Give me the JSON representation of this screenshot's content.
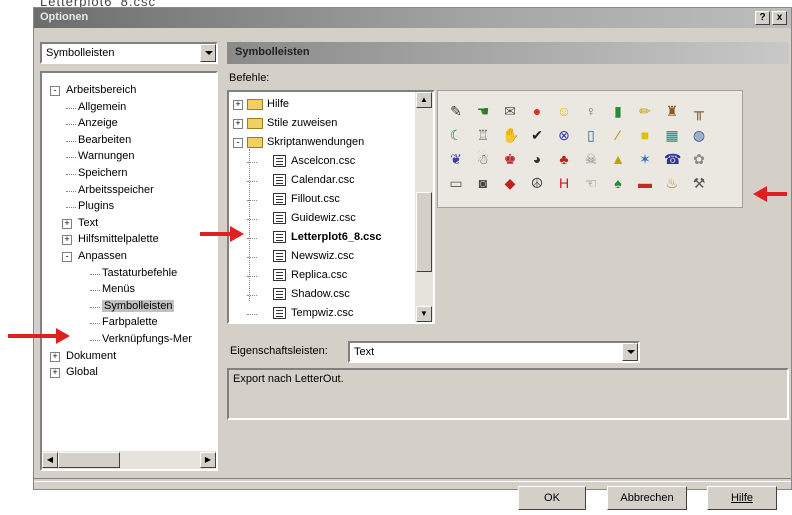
{
  "top_text": "Letterplot6_8.csc",
  "window": {
    "title": "Optionen",
    "help_btn": "?",
    "close_btn": "x"
  },
  "category_combo": {
    "value": "Symbolleisten"
  },
  "left_tree": [
    {
      "label": "Arbeitsbereich",
      "level": 0,
      "expander": "-"
    },
    {
      "label": "Allgemein",
      "level": 1
    },
    {
      "label": "Anzeige",
      "level": 1
    },
    {
      "label": "Bearbeiten",
      "level": 1
    },
    {
      "label": "Warnungen",
      "level": 1
    },
    {
      "label": "Speichern",
      "level": 1
    },
    {
      "label": "Arbeitsspeicher",
      "level": 1
    },
    {
      "label": "Plugins",
      "level": 1
    },
    {
      "label": "Text",
      "level": 1,
      "expander": "+"
    },
    {
      "label": "Hilfsmittelpalette",
      "level": 1,
      "expander": "+"
    },
    {
      "label": "Anpassen",
      "level": 1,
      "expander": "-"
    },
    {
      "label": "Tastaturbefehle",
      "level": 2
    },
    {
      "label": "Menüs",
      "level": 2
    },
    {
      "label": "Symbolleisten",
      "level": 2,
      "selected": true
    },
    {
      "label": "Farbpalette",
      "level": 2
    },
    {
      "label": "Verknüpfungs-Mer",
      "level": 2
    },
    {
      "label": "Dokument",
      "level": 0,
      "expander": "+"
    },
    {
      "label": "Global",
      "level": 0,
      "expander": "+"
    }
  ],
  "section_header": "Symbolleisten",
  "commands_label": "Befehle:",
  "commands_tree": [
    {
      "label": "Hilfe",
      "type": "folder",
      "expander": "+"
    },
    {
      "label": "Stile zuweisen",
      "type": "folder",
      "expander": "+"
    },
    {
      "label": "Skriptanwendungen",
      "type": "folder",
      "expander": "-"
    },
    {
      "label": "Ascelcon.csc",
      "type": "file"
    },
    {
      "label": "Calendar.csc",
      "type": "file"
    },
    {
      "label": "Fillout.csc",
      "type": "file"
    },
    {
      "label": "Guidewiz.csc",
      "type": "file"
    },
    {
      "label": "Letterplot6_8.csc",
      "type": "file",
      "highlight": true
    },
    {
      "label": "Newswiz.csc",
      "type": "file"
    },
    {
      "label": "Replica.csc",
      "type": "file"
    },
    {
      "label": "Shadow.csc",
      "type": "file"
    },
    {
      "label": "Tempwiz.csc",
      "type": "file"
    }
  ],
  "icon_grid": [
    [
      "pen-icon",
      "hand-icon",
      "mail-icon",
      "stop-icon",
      "smiley-icon",
      "bulb-icon",
      "book-icon",
      "pencil-icon",
      "chair-icon",
      "table-icon"
    ],
    [
      "moon-icon",
      "bottle-icon",
      "glove-icon",
      "check-icon",
      "no-icon",
      "page-icon",
      "wand-icon",
      "cube-icon",
      "grid-icon",
      "globe-icon"
    ],
    [
      "butterfly-icon",
      "figure-icon",
      "person-icon",
      "camera-icon",
      "car-icon",
      "skull-icon",
      "bell-icon",
      "star-icon",
      "phone-icon",
      "flower-icon"
    ],
    [
      "card-icon",
      "chip-icon",
      "lips-icon",
      "peace-icon",
      "h-icon",
      "hand-point-icon",
      "tree-icon",
      "sofa-icon",
      "pumpkin-icon",
      "tools-icon"
    ]
  ],
  "icon_glyphs": {
    "pen-icon": "✎",
    "hand-icon": "☚",
    "mail-icon": "✉",
    "stop-icon": "●",
    "smiley-icon": "☺",
    "bulb-icon": "♀",
    "book-icon": "▮",
    "pencil-icon": "✏",
    "chair-icon": "♜",
    "table-icon": "╥",
    "moon-icon": "☾",
    "bottle-icon": "♖",
    "glove-icon": "✋",
    "check-icon": "✔",
    "no-icon": "⊗",
    "page-icon": "▯",
    "wand-icon": "⁄",
    "cube-icon": "■",
    "grid-icon": "▦",
    "globe-icon": "◍",
    "butterfly-icon": "❦",
    "figure-icon": "☃",
    "person-icon": "♚",
    "camera-icon": "◕",
    "car-icon": "♣",
    "skull-icon": "☠",
    "bell-icon": "▲",
    "star-icon": "✶",
    "phone-icon": "☎",
    "flower-icon": "✿",
    "card-icon": "▭",
    "chip-icon": "◙",
    "lips-icon": "◆",
    "peace-icon": "☮",
    "h-icon": "H",
    "hand-point-icon": "☜",
    "tree-icon": "♠",
    "sofa-icon": "▬",
    "pumpkin-icon": "♨",
    "tools-icon": "⚒"
  },
  "icon_colors": [
    "#3a3a3a",
    "#2a7a2a",
    "#555",
    "#e03020",
    "#e0c000",
    "#777",
    "#2a8a3a",
    "#c0a000",
    "#8a5a20",
    "#6a4a20",
    "#2a7a2a",
    "#6a6a6a",
    "#666",
    "#222",
    "#3030c0",
    "#2a6a9a",
    "#c08000",
    "#e0c000",
    "#1a8a8a",
    "#2a5aa0",
    "#4040a0",
    "#555",
    "#b02020",
    "#333",
    "#c02020",
    "#888",
    "#c0a000",
    "#3070c0",
    "#3030a0",
    "#888",
    "#555",
    "#444",
    "#c02020",
    "#444",
    "#c02020",
    "#777",
    "#2a8a3a",
    "#c03020",
    "#c07020",
    "#555"
  ],
  "properties_label": "Eigenschaftsleisten:",
  "properties_combo": {
    "value": "Text"
  },
  "description": "Export nach LetterOut.",
  "buttons": {
    "ok": "OK",
    "cancel": "Abbrechen",
    "help": "Hilfe"
  },
  "colors": {
    "dialog_bg": "#d4d0c8",
    "accent_arrow": "#e02020",
    "selection": "#0a246a"
  }
}
